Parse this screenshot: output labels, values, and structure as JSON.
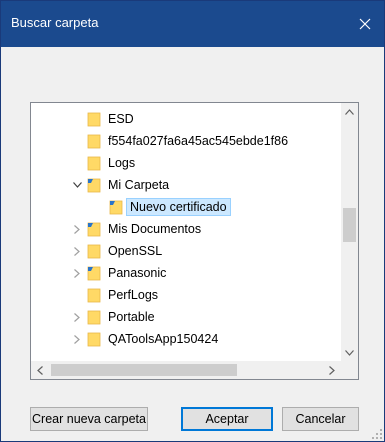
{
  "dialog": {
    "title": "Buscar carpeta",
    "close_glyph": "✕"
  },
  "tree": {
    "items": [
      {
        "label": "ESD",
        "icon": "folder-icon",
        "expander": "",
        "selected": false
      },
      {
        "label": "f554fa027fa6a45ac545ebde1f86",
        "icon": "folder-icon",
        "expander": "",
        "selected": false
      },
      {
        "label": "Logs",
        "icon": "folder-icon",
        "expander": "",
        "selected": false
      },
      {
        "label": "Mi Carpeta",
        "icon": "shared-folder-icon",
        "expander": "expanded",
        "selected": false
      },
      {
        "label": "Nuevo certificado",
        "icon": "shared-folder-icon",
        "expander": "",
        "selected": true
      },
      {
        "label": "Mis Documentos",
        "icon": "shared-folder-icon",
        "expander": "collapsed",
        "selected": false
      },
      {
        "label": "OpenSSL",
        "icon": "folder-icon",
        "expander": "collapsed",
        "selected": false
      },
      {
        "label": "Panasonic",
        "icon": "shared-folder-icon",
        "expander": "collapsed",
        "selected": false
      },
      {
        "label": "PerfLogs",
        "icon": "folder-icon",
        "expander": "",
        "selected": false
      },
      {
        "label": "Portable",
        "icon": "folder-icon",
        "expander": "collapsed",
        "selected": false
      },
      {
        "label": "QAToolsApp150424",
        "icon": "folder-icon",
        "expander": "collapsed",
        "selected": false
      }
    ]
  },
  "buttons": {
    "new_folder": "Crear nueva carpeta",
    "accept": "Aceptar",
    "cancel": "Cancelar"
  },
  "colors": {
    "titlebar": "#1b4a8e",
    "selection": "#cce8ff",
    "folder": "#ffd966",
    "folder_dark": "#e8b84a"
  }
}
